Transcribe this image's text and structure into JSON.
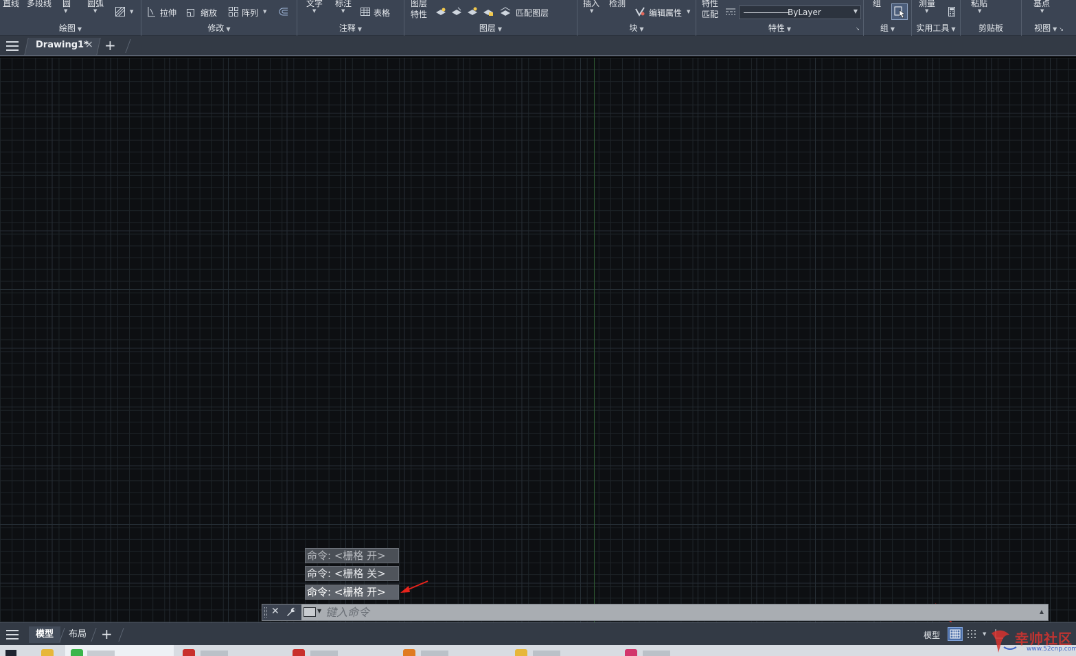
{
  "ribbon": {
    "draw": {
      "label": "绘图",
      "line": "直线",
      "polyline": "多段线",
      "circle": "圆",
      "arc": "圆弧"
    },
    "modify": {
      "label": "修改",
      "stretch": "拉伸",
      "scale": "缩放",
      "array": "阵列"
    },
    "annotation": {
      "label": "注释",
      "text": "文字",
      "dimension": "标注",
      "table": "表格"
    },
    "layers": {
      "label": "图层",
      "properties_line1": "图层",
      "properties_line2": "特性",
      "match_layer": "匹配图层"
    },
    "block": {
      "label": "块",
      "insert": "插入",
      "detect": "检测",
      "edit_attributes": "编辑属性"
    },
    "properties": {
      "label": "特性",
      "match_line1": "特性",
      "match_line2": "匹配",
      "linetype": "ByLayer"
    },
    "groups": {
      "label": "组",
      "group": "组"
    },
    "utilities": {
      "label": "实用工具",
      "measure": "测量"
    },
    "clipboard": {
      "label": "剪贴板",
      "paste": "粘贴"
    },
    "view": {
      "label": "视图",
      "base": "基点"
    }
  },
  "tabs": {
    "document": "Drawing1*"
  },
  "command_history": [
    "命令: <栅格 开>",
    "命令: <栅格 关>",
    "命令: <栅格 开>"
  ],
  "command_line": {
    "placeholder": "键入命令"
  },
  "status_bar": {
    "model_tab": "模型",
    "layout_tab": "布局",
    "model_space": "模型"
  },
  "watermark": {
    "text": "幸帅社区",
    "url": "www.52cnp.com"
  },
  "colors": {
    "ribbon_bg": "#3b4453",
    "canvas_bg": "#0d0f12",
    "grid_active": "#4a6ea9",
    "annotation_arrow": "#e8231b"
  }
}
